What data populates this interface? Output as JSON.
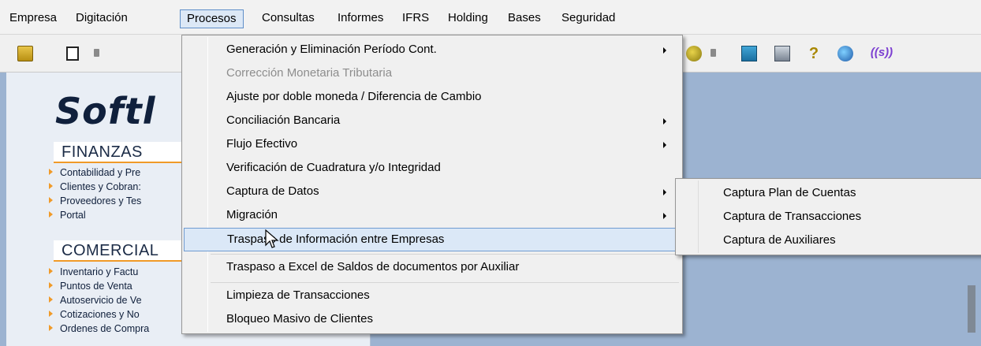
{
  "menubar": {
    "items": [
      "Empresa",
      "Digitación",
      "Procesos",
      "Consultas",
      "Informes",
      "IFRS",
      "Holding",
      "Bases",
      "Seguridad"
    ],
    "active_index": 2
  },
  "toolbar": {
    "icons": [
      "open-folder-icon",
      "new-document-icon",
      "dropdown-arrow-icon",
      "keys-icon",
      "dropdown-arrow-icon",
      "calculator-icon",
      "printer-icon",
      "help-icon",
      "globe-icon",
      "softland-logo-icon"
    ],
    "help_glyph": "?",
    "logo_text": "((s))"
  },
  "left_panel": {
    "brand": "Softl",
    "sections": [
      {
        "title": "FINANZAS",
        "items": [
          "Contabilidad y Pre",
          "Clientes y Cobran:",
          "Proveedores y Tes",
          "Portal"
        ]
      },
      {
        "title": "COMERCIAL",
        "items": [
          "Inventario y Factu",
          "Puntos de Venta",
          "Autoservicio de Ve",
          "Cotizaciones y No",
          "Ordenes de Compra"
        ]
      }
    ]
  },
  "procesos_menu": {
    "items": [
      {
        "label": "Generación y Eliminación Período Cont.",
        "submenu": true,
        "disabled": false
      },
      {
        "label": "Corrección Monetaria Tributaria",
        "submenu": false,
        "disabled": true
      },
      {
        "label": "Ajuste por doble moneda / Diferencia de Cambio",
        "submenu": false,
        "disabled": false
      },
      {
        "label": "Conciliación Bancaria",
        "submenu": true,
        "disabled": false
      },
      {
        "label": "Flujo Efectivo",
        "submenu": true,
        "disabled": false
      },
      {
        "label": "Verificación de Cuadratura y/o Integridad",
        "submenu": false,
        "disabled": false
      },
      {
        "label": "Captura de Datos",
        "submenu": true,
        "disabled": false
      },
      {
        "label": "Migración",
        "submenu": true,
        "disabled": false
      },
      {
        "label": "Traspaso de Información entre Empresas",
        "submenu": false,
        "disabled": false,
        "hover": true
      },
      {
        "label": "Traspaso a Excel de Saldos de documentos por Auxiliar",
        "submenu": false,
        "disabled": false
      },
      {
        "label": "Limpieza de Transacciones",
        "submenu": false,
        "disabled": false
      },
      {
        "label": "Bloqueo Masivo de Clientes",
        "submenu": false,
        "disabled": false
      }
    ]
  },
  "captura_submenu": {
    "items": [
      "Captura Plan de Cuentas",
      "Captura de Transacciones",
      "Captura de Auxiliares"
    ]
  },
  "colors": {
    "workspace": "#9cb3d1",
    "accent_orange": "#f09a28",
    "hover_fill": "#dbe8f7",
    "hover_border": "#6f9bd1"
  }
}
